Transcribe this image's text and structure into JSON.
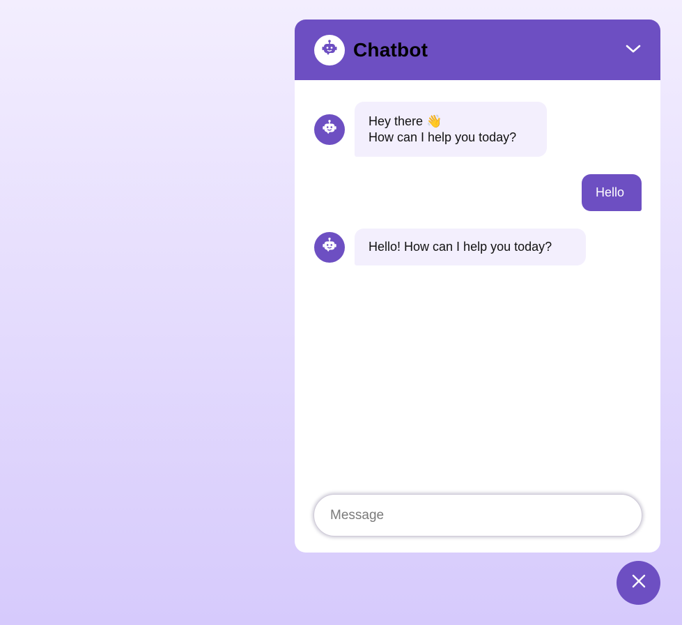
{
  "header": {
    "title": "Chatbot",
    "avatar_icon": "robot-icon",
    "collapse_icon": "chevron-down-icon"
  },
  "messages": [
    {
      "role": "bot",
      "lines": [
        "Hey there 👋",
        "How can I help you today?"
      ]
    },
    {
      "role": "user",
      "text": "Hello"
    },
    {
      "role": "bot",
      "text": "Hello! How can I help you today?"
    }
  ],
  "composer": {
    "placeholder": "Message",
    "value": ""
  },
  "toggle_button": {
    "icon": "close-icon"
  },
  "colors": {
    "accent": "#6d4fc2",
    "bot_bubble": "#f3effd",
    "background_top": "#f3eefe",
    "background_bottom": "#d6cafc"
  }
}
